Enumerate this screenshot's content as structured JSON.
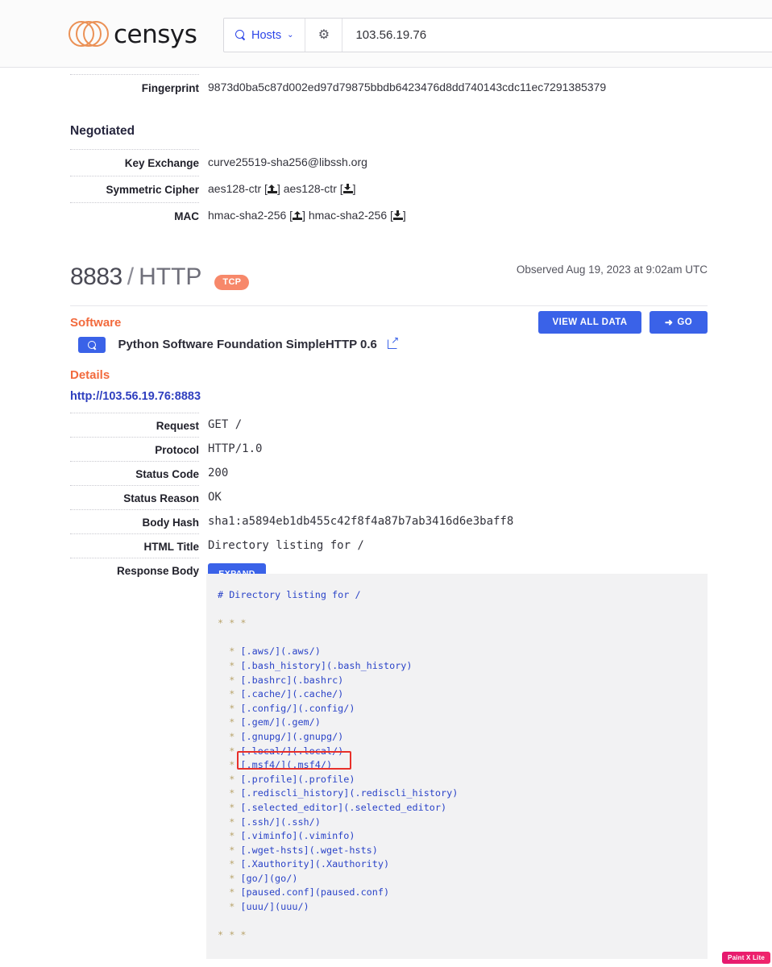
{
  "header": {
    "brand": "censys",
    "search_scope": "Hosts",
    "search_value": "103.56.19.76",
    "gear_icon": "gear-icon",
    "chevron_icon": "chevron-down-icon",
    "search_icon": "search-icon"
  },
  "tls": {
    "fingerprint_label": "Fingerprint",
    "fingerprint_value": "9873d0ba5c87d002ed97d79875bbdb6423476d8dd740143cdc11ec7291385379",
    "negotiated_title": "Negotiated",
    "rows": [
      {
        "label": "Key Exchange",
        "value": "curve25519-sha256@libssh.org",
        "icons": false
      },
      {
        "label": "Symmetric Cipher",
        "value_a": "aes128-ctr",
        "value_b": "aes128-ctr",
        "icons": true
      },
      {
        "label": "MAC",
        "value_a": "hmac-sha2-256",
        "value_b": "hmac-sha2-256",
        "icons": true
      }
    ]
  },
  "port": {
    "number": "8883",
    "separator": "/",
    "protocol": "HTTP",
    "transport_badge": "TCP",
    "observed": "Observed Aug 19, 2023 at 9:02am UTC"
  },
  "software": {
    "title": "Software",
    "name": "Python Software Foundation SimpleHTTP 0.6",
    "view_all_label": "VIEW ALL DATA",
    "go_label": "GO",
    "go_icon": "arrow-go-icon",
    "pivot_icon": "search-pivot-icon",
    "external_icon": "external-link-icon"
  },
  "details": {
    "title": "Details",
    "url": "http://103.56.19.76:8883",
    "rows": [
      {
        "label": "Request",
        "value": "GET /"
      },
      {
        "label": "Protocol",
        "value": "HTTP/1.0"
      },
      {
        "label": "Status Code",
        "value": "200"
      },
      {
        "label": "Status Reason",
        "value": "OK"
      },
      {
        "label": "Body Hash",
        "value": "sha1:a5894eb1db455c42f8f4a87b7ab3416d6e3baff8"
      },
      {
        "label": "HTML Title",
        "value": "Directory listing for /"
      }
    ],
    "response_body_label": "Response Body",
    "expand_label": "EXPAND"
  },
  "response_body": {
    "heading": "# Directory listing for /",
    "rule_top": "* * *",
    "rule_bottom": "* * *",
    "entries": [
      "[.aws/](.aws/)",
      "[.bash_history](.bash_history)",
      "[.bashrc](.bashrc)",
      "[.cache/](.cache/)",
      "[.config/](.config/)",
      "[.gem/](.gem/)",
      "[.gnupg/](.gnupg/)",
      "[.local/](.local/)",
      "[.msf4/](.msf4/)",
      "[.profile](.profile)",
      "[.rediscli_history](.rediscli_history)",
      "[.selected_editor](.selected_editor)",
      "[.ssh/](.ssh/)",
      "[.viminfo](.viminfo)",
      "[.wget-hsts](.wget-hsts)",
      "[.Xauthority](.Xauthority)",
      "[go/](go/)",
      "[paused.conf](paused.conf)",
      "[uuu/](uuu/)"
    ],
    "highlighted_entry": "[.msf4/](.msf4/)",
    "highlight_color": "#e8302a"
  },
  "watermark": {
    "text": "Paint X Lite"
  },
  "colors": {
    "accent_blue": "#3a62e8",
    "accent_orange": "#f26a3d",
    "badge_salmon": "#f7886a",
    "code_blue": "#2b44c8",
    "code_bg": "#f2f2f3"
  }
}
